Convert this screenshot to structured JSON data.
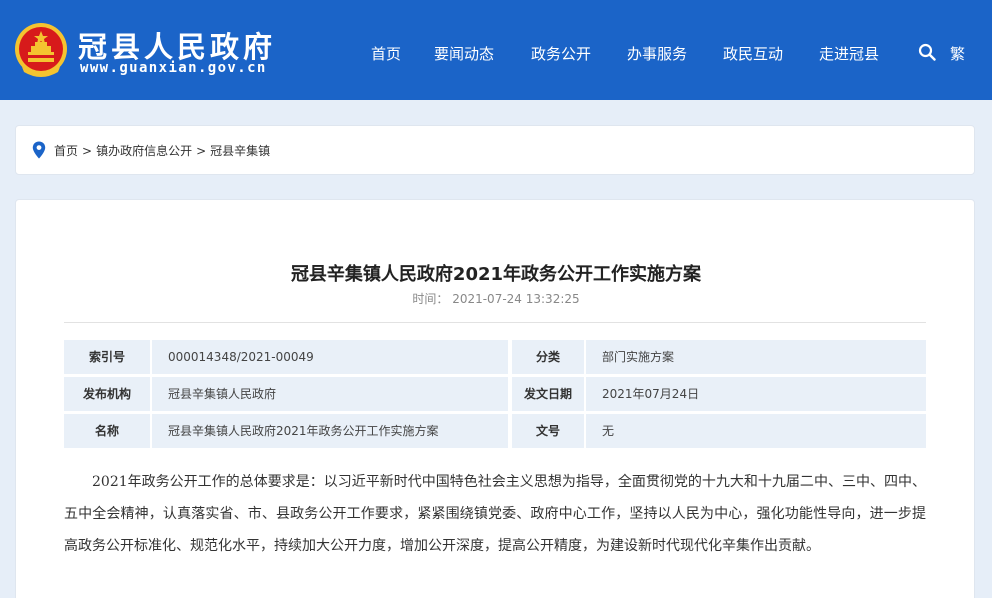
{
  "header": {
    "site_name": "冠县人民政府",
    "site_domain": "www.guanxian.gov.cn",
    "nav": [
      "首页",
      "要闻动态",
      "政务公开",
      "办事服务",
      "政民互动",
      "走进冠县"
    ],
    "traditional_label": "繁",
    "colors": {
      "primary": "#1b64c8",
      "emblem_red": "#d71a1b",
      "emblem_gold": "#f4c430"
    }
  },
  "breadcrumb": {
    "items": [
      "首页",
      "镇办政府信息公开",
      "冠县辛集镇"
    ],
    "separator": ">"
  },
  "article": {
    "title": "冠县辛集镇人民政府2021年政务公开工作实施方案",
    "time_label": "时间：",
    "time_value": "2021-07-24 13:32:25",
    "meta": [
      [
        {
          "k": "索引号",
          "v": "000014348/2021-00049"
        },
        {
          "k": "分类",
          "v": "部门实施方案"
        }
      ],
      [
        {
          "k": "发布机构",
          "v": "冠县辛集镇人民政府"
        },
        {
          "k": "发文日期",
          "v": "2021年07月24日"
        }
      ],
      [
        {
          "k": "名称",
          "v": "冠县辛集镇人民政府2021年政务公开工作实施方案"
        },
        {
          "k": "文号",
          "v": "无"
        }
      ]
    ],
    "body": "2021年政务公开工作的总体要求是：以习近平新时代中国特色社会主义思想为指导，全面贯彻党的十九大和十九届二中、三中、四中、五中全会精神，认真落实省、市、县政务公开工作要求，紧紧围绕镇党委、政府中心工作，坚持以人民为中心，强化功能性导向，进一步提高政务公开标准化、规范化水平，持续加大公开力度，增加公开深度，提高公开精度，为建设新时代现代化辛集作出贡献。"
  }
}
